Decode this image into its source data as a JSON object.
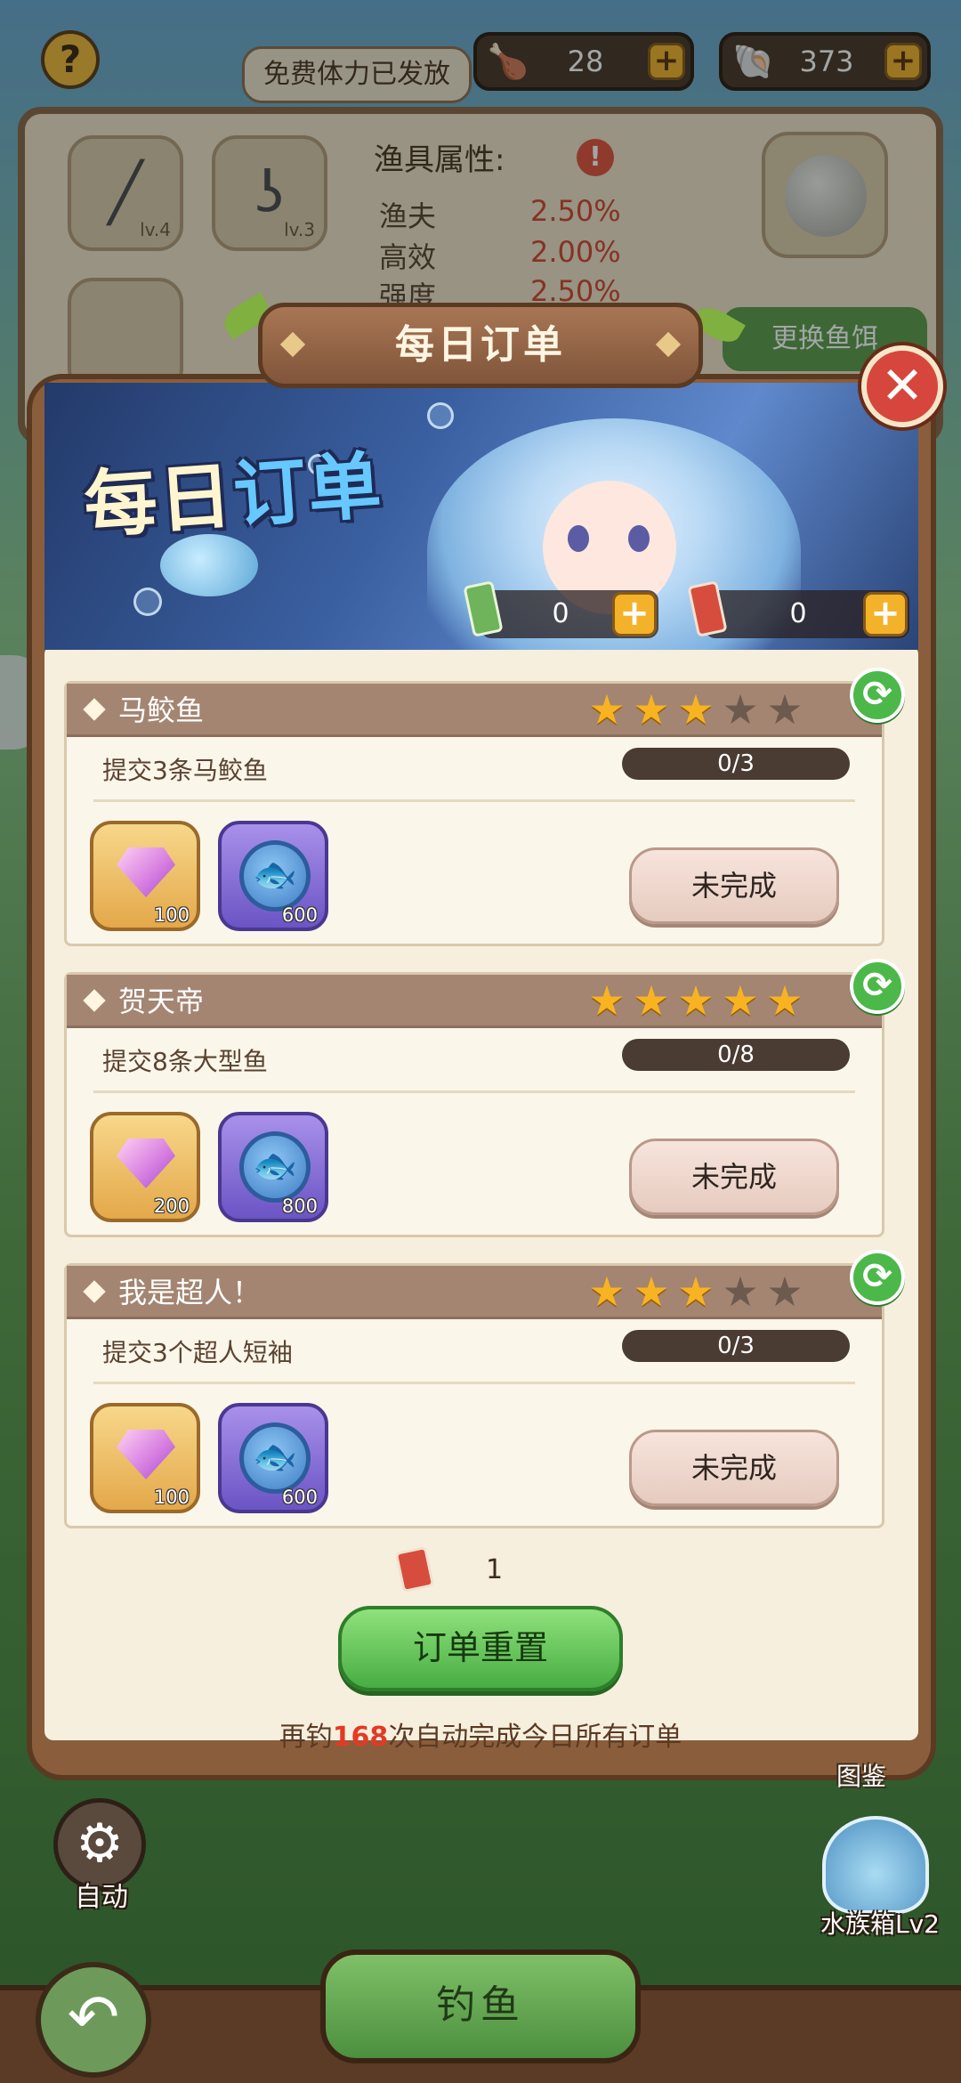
{
  "top_bar": {
    "help_label": "?",
    "notice": "免费体力已发放",
    "stamina": {
      "icon": "drumstick-icon",
      "value": "28",
      "plus_label": "+"
    },
    "pearls": {
      "icon": "shell-icon",
      "value": "373",
      "plus_label": "+"
    }
  },
  "gear_panel": {
    "slots": [
      {
        "icon": "fishing-rod-icon",
        "level": "lv.4"
      },
      {
        "icon": "fish-hook-icon",
        "level": "lv.3"
      }
    ],
    "attributes_title": "渔具属性:",
    "attributes": [
      {
        "name": "渔夫",
        "value": "2.50%"
      },
      {
        "name": "高效",
        "value": "2.00%"
      },
      {
        "name": "强度",
        "value": "2.50%"
      }
    ],
    "change_bait_label": "更换鱼饵"
  },
  "modal": {
    "title": "每日订单",
    "banner_title_part1": "每日",
    "banner_title_part2": "订单",
    "close_label": "✕",
    "ticket_green": {
      "value": "0",
      "plus_label": "+"
    },
    "ticket_red": {
      "value": "0",
      "plus_label": "+"
    },
    "orders": [
      {
        "name": "马鲛鱼",
        "stars_on": 3,
        "stars_total": 5,
        "task": "提交3条马鲛鱼",
        "progress": "0/3",
        "reward_gem_amount": "100",
        "reward_coin_amount": "600",
        "status": "未完成"
      },
      {
        "name": "贺天帝",
        "stars_on": 5,
        "stars_total": 5,
        "task": "提交8条大型鱼",
        "progress": "0/8",
        "reward_gem_amount": "200",
        "reward_coin_amount": "800",
        "status": "未完成"
      },
      {
        "name": "我是超人！",
        "stars_on": 3,
        "stars_total": 5,
        "task": "提交3个超人短袖",
        "progress": "0/3",
        "reward_gem_amount": "100",
        "reward_coin_amount": "600",
        "status": "未完成"
      }
    ],
    "reset_ticket_count": "1",
    "reset_label": "订单重置",
    "auto_text_prefix": "再钓",
    "auto_text_number": "168",
    "auto_text_suffix": "次自动完成今日所有订单"
  },
  "bottom": {
    "auto_label": "自动",
    "illustrated_label": "图鉴",
    "tank_label": "水族箱Lv2",
    "fish_label": "钓鱼",
    "back_label": "↶"
  },
  "colors": {
    "modal_frame": "#8a5e3c",
    "card_header": "#a38572",
    "star_on": "#f7b321",
    "reset_button": "#47ad42",
    "highlight_number": "#e33a25"
  }
}
